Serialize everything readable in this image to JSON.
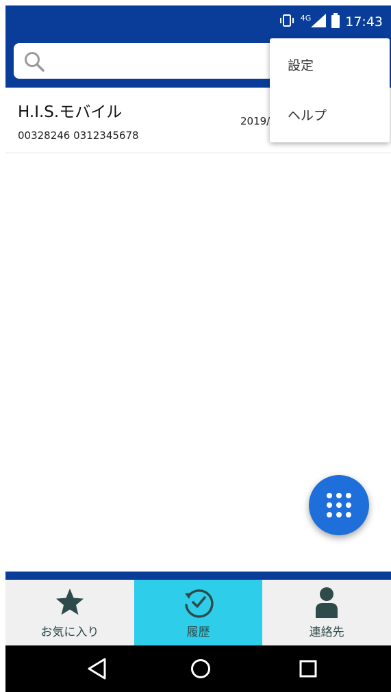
{
  "status_bar": {
    "network_label": "4G",
    "time": "17:43",
    "icons": [
      "vibrate-icon",
      "signal-icon",
      "battery-icon"
    ]
  },
  "search": {
    "icon": "search-icon",
    "placeholder": ""
  },
  "history": [
    {
      "name": "H.I.S.モバイル",
      "number": "00328246 0312345678",
      "date": "2019/"
    }
  ],
  "overflow_menu": {
    "items": [
      "設定",
      "ヘルプ"
    ]
  },
  "fab": {
    "icon": "dialpad-icon"
  },
  "bottom_tabs": [
    {
      "label": "お気に入り",
      "icon": "star-icon",
      "active": false
    },
    {
      "label": "履歴",
      "icon": "clock-icon",
      "active": true
    },
    {
      "label": "連絡先",
      "icon": "person-icon",
      "active": false
    }
  ],
  "nav_bar": {
    "icons": [
      "back-icon",
      "home-icon",
      "recents-icon"
    ]
  },
  "colors": {
    "header": "#0a3d9a",
    "active_tab": "#2ecde9",
    "fab": "#1e6fd9",
    "tab_icon": "#2f4a4a"
  }
}
